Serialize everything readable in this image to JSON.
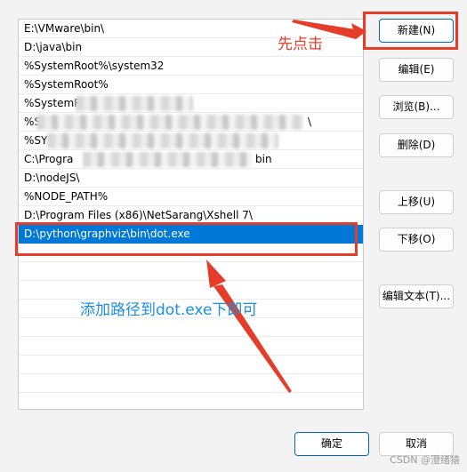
{
  "path_list": {
    "items": [
      {
        "text": "E:\\VMware\\bin\\",
        "selected": false
      },
      {
        "text": "D:\\java\\bin",
        "selected": false
      },
      {
        "text": "%SystemRoot%\\system32",
        "selected": false
      },
      {
        "text": "%SystemRoot%",
        "selected": false
      },
      {
        "text": "%SystemR",
        "selected": false
      },
      {
        "text": "%S",
        "selected": false
      },
      {
        "text": "%SY",
        "selected": false
      },
      {
        "text": "C:\\Progra",
        "selected": false
      },
      {
        "text": "D:\\nodeJS\\",
        "selected": false
      },
      {
        "text": "%NODE_PATH%",
        "selected": false
      },
      {
        "text": "D:\\Program Files (x86)\\NetSarang\\Xshell 7\\",
        "selected": false
      },
      {
        "text": "D:\\python\\graphviz\\bin\\dot.exe",
        "selected": true
      }
    ],
    "partial_fragments": {
      "row5_tail": "\\",
      "row7_tail": "bin"
    }
  },
  "buttons": {
    "new": "新建(N)",
    "edit": "编辑(E)",
    "browse": "浏览(B)...",
    "delete": "删除(D)",
    "move_up": "上移(U)",
    "move_down": "下移(O)",
    "edit_text": "编辑文本(T)...",
    "ok": "确定",
    "cancel": "取消"
  },
  "annotations": {
    "click_first": "先点击",
    "add_path": "添加路径到dot.exe下即可",
    "colors": {
      "red": "#e63d2b",
      "blue": "#1a8fe0"
    }
  },
  "watermark": "CSDN @澄绪猿"
}
